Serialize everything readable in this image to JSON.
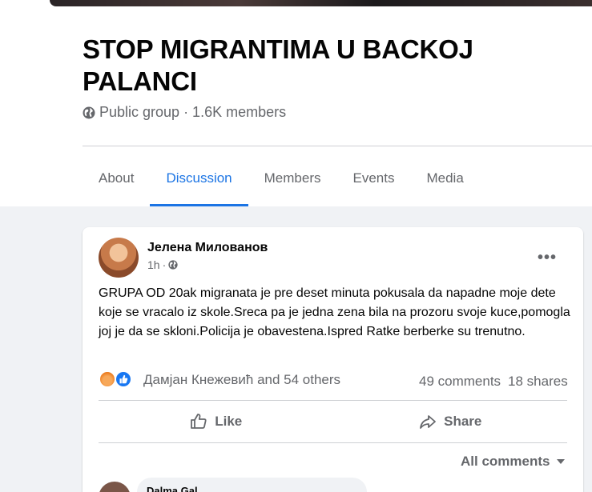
{
  "group": {
    "title": "STOP MIGRANTIMA U BACKOJ PALANCI",
    "meta": "Public group · 1.6K members"
  },
  "tabs": [
    {
      "label": "About"
    },
    {
      "label": "Discussion",
      "active": true
    },
    {
      "label": "Members"
    },
    {
      "label": "Events"
    },
    {
      "label": "Media"
    }
  ],
  "post": {
    "author": "Јелена Милованов",
    "time": "1h",
    "text": "GRUPA OD 20ak migranata je pre deset minuta pokusala da napadne moje dete koje se vracalo iz skole.Sreca pa je jedna zena bila na prozoru svoje kuce,pomogla joj je da se skloni.Policija je obavestena.Ispred Ratke berberke su trenutno.",
    "reactions_text": "Дамјан Кнежевић and 54 others",
    "comments_count": "49 comments",
    "shares_count": "18 shares",
    "like_label": "Like",
    "share_label": "Share",
    "all_comments_label": "All comments",
    "comment_preview_author": "Dalma Gal..."
  },
  "colors": {
    "accent": "#1b74e4",
    "like_blue": "#1877f2",
    "secondary_text": "#65676b"
  }
}
